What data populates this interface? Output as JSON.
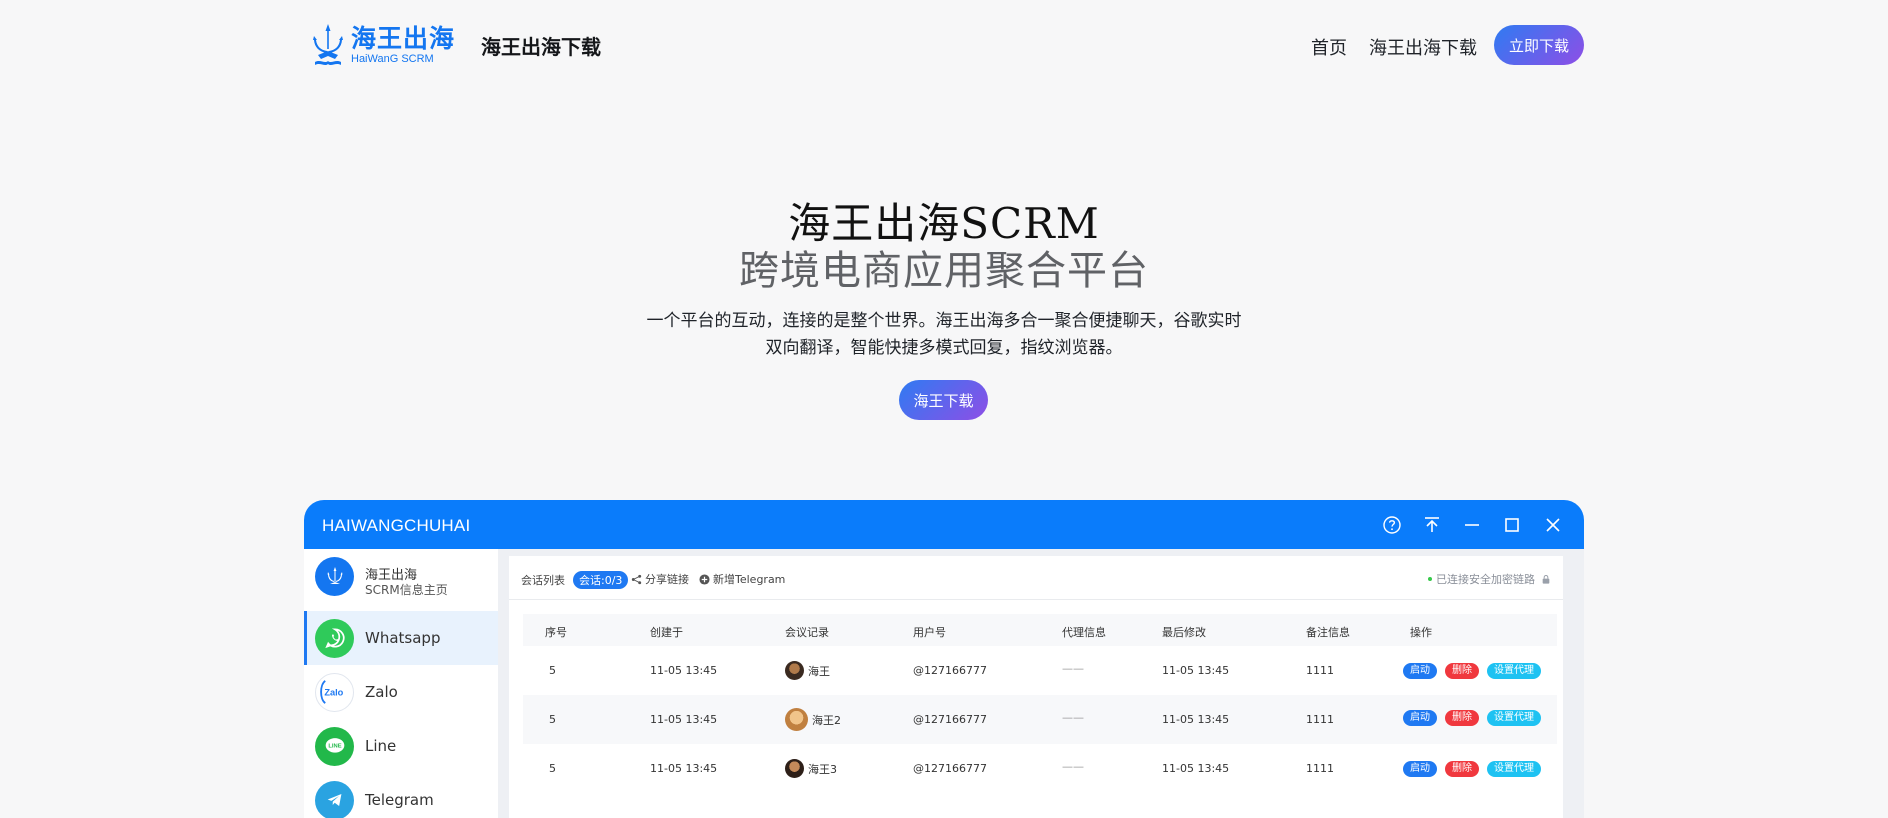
{
  "header": {
    "logo_cn": "海王出海",
    "logo_en": "HaiWanG SCRM",
    "brand_title": "海王出海下载",
    "nav": [
      "首页",
      "海王出海下载"
    ],
    "cta": "立即下载"
  },
  "hero": {
    "title1": "海王出海SCRM",
    "title2": "跨境电商应用聚合平台",
    "desc": "一个平台的互动，连接的是整个世界。海王出海多合一聚合便捷聊天，谷歌实时双向翻译，智能快捷多模式回复，指纹浏览器。",
    "button": "海王下载"
  },
  "app": {
    "title": "HAIWANGCHUHAI",
    "sidebar": {
      "head_title": "海王出海",
      "head_sub": "SCRM信息主页",
      "items": [
        "Whatsapp",
        "Zalo",
        "Line",
        "Telegram"
      ]
    },
    "toolbar": {
      "list_label": "会话列表",
      "badge": "会话:0/3",
      "share": "分享链接",
      "add": "新增Telegram",
      "secure": "已连接安全加密链路"
    },
    "table": {
      "headers": [
        "序号",
        "创建于",
        "会议记录",
        "用户号",
        "代理信息",
        "最后修改",
        "备注信息",
        "操作"
      ],
      "rows": [
        {
          "no": "5",
          "created": "11-05 13:45",
          "name": "海王",
          "user": "@127166777",
          "proxy": "——",
          "modified": "11-05 13:45",
          "note": "1111"
        },
        {
          "no": "5",
          "created": "11-05 13:45",
          "name": "海王2",
          "user": "@127166777",
          "proxy": "——",
          "modified": "11-05 13:45",
          "note": "1111"
        },
        {
          "no": "5",
          "created": "11-05 13:45",
          "name": "海王3",
          "user": "@127166777",
          "proxy": "——",
          "modified": "11-05 13:45",
          "note": "1111"
        }
      ],
      "ops": [
        "启动",
        "删除",
        "设置代理"
      ]
    }
  },
  "colors": {
    "accent": "#0a7cfb",
    "gradient_start": "#2f7bf2",
    "gradient_end": "#8e4ee6",
    "delete": "#f0383e",
    "proxy": "#1ec2f2"
  }
}
